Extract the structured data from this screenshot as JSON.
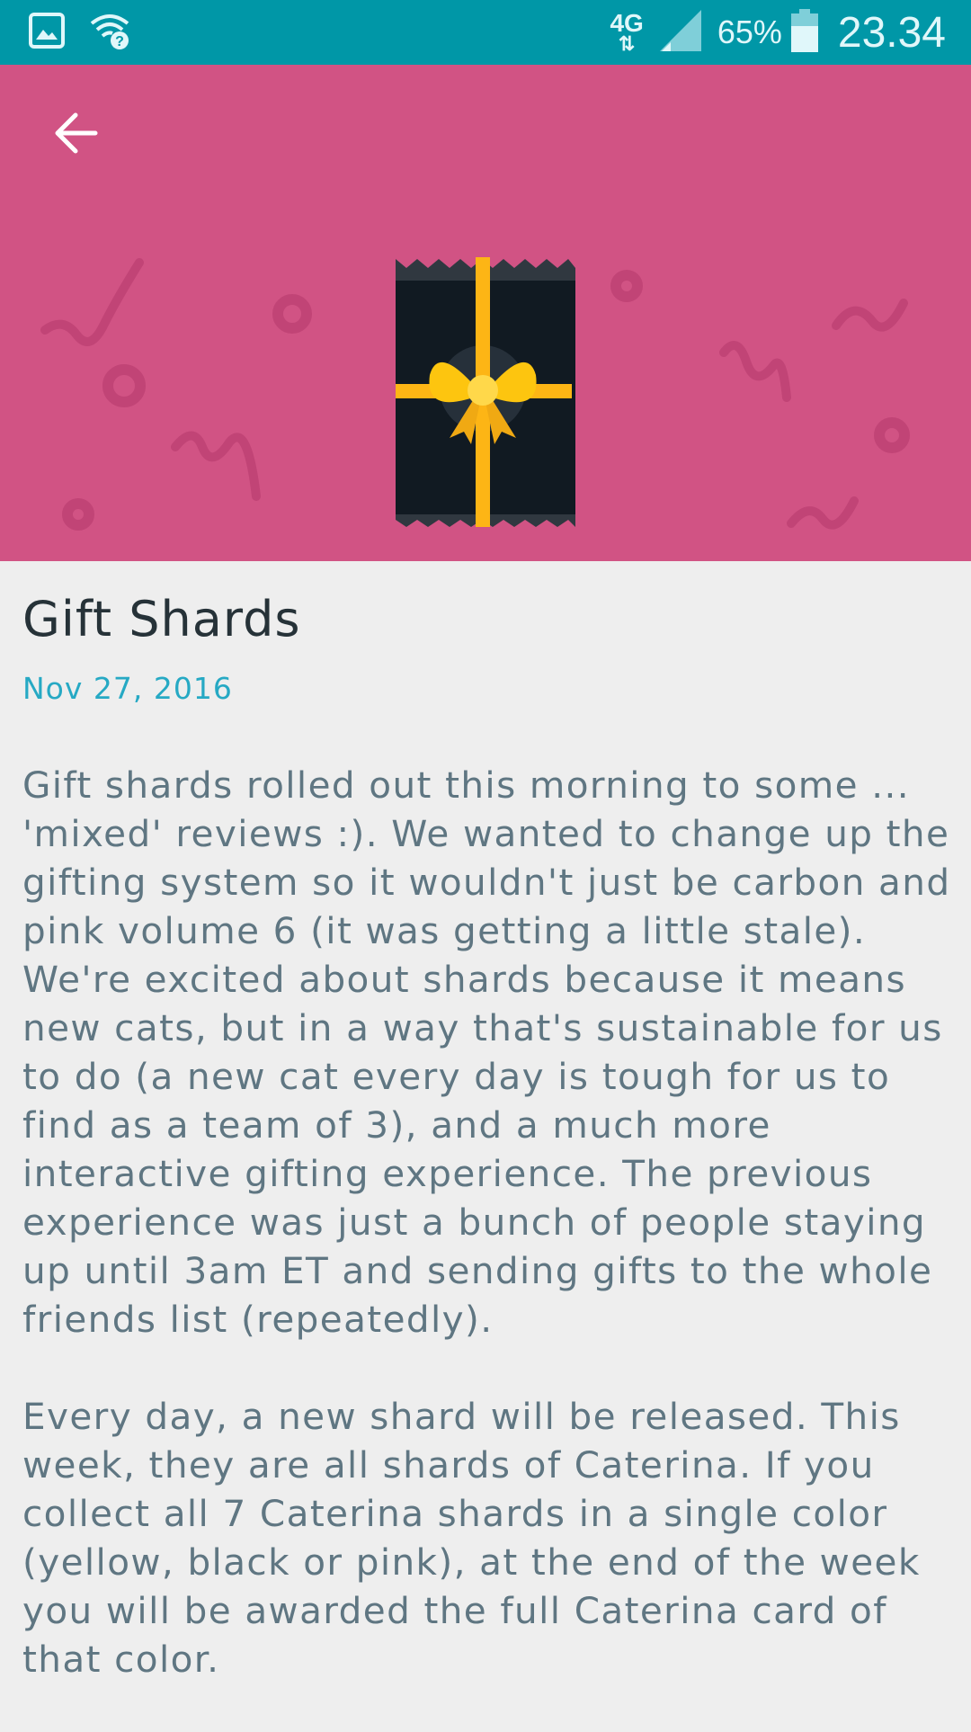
{
  "status_bar": {
    "network_type": "4G",
    "battery_percent": "65%",
    "time": "23.34",
    "icons": [
      "image-notification-icon",
      "wifi-unknown-icon",
      "data-transfer-icon",
      "signal-icon",
      "battery-icon"
    ]
  },
  "header": {
    "background_color": "#d15384",
    "back_icon": "arrow-left-icon",
    "image": "gift-box-illustration"
  },
  "article": {
    "title": "Gift Shards",
    "date": "Nov 27, 2016",
    "paragraphs": [
      "Gift shards rolled out this morning to some ... 'mixed' reviews :). We wanted to change up the gifting system so it wouldn't just be carbon and pink volume 6 (it was getting a little stale). We're excited about shards because it means new cats, but in a way that's sustainable for us to do (a new cat every day is tough for us to find as a team of 3), and a much more interactive gifting experience. The previous experience was just a bunch of people staying up until 3am ET and sending gifts to the whole friends list (repeatedly).",
      "Every day, a new shard will be released. This week, they are all shards of Caterina. If you collect all 7 Caterina shards in a single color (yellow, black or pink), at the end of the week you will be awarded the full Caterina card of that color."
    ]
  },
  "colors": {
    "status_bar": "#0097a7",
    "date_accent": "#26a9c4",
    "title_text": "#263238",
    "body_text": "#5f7682",
    "ribbon": "#fdb515"
  }
}
